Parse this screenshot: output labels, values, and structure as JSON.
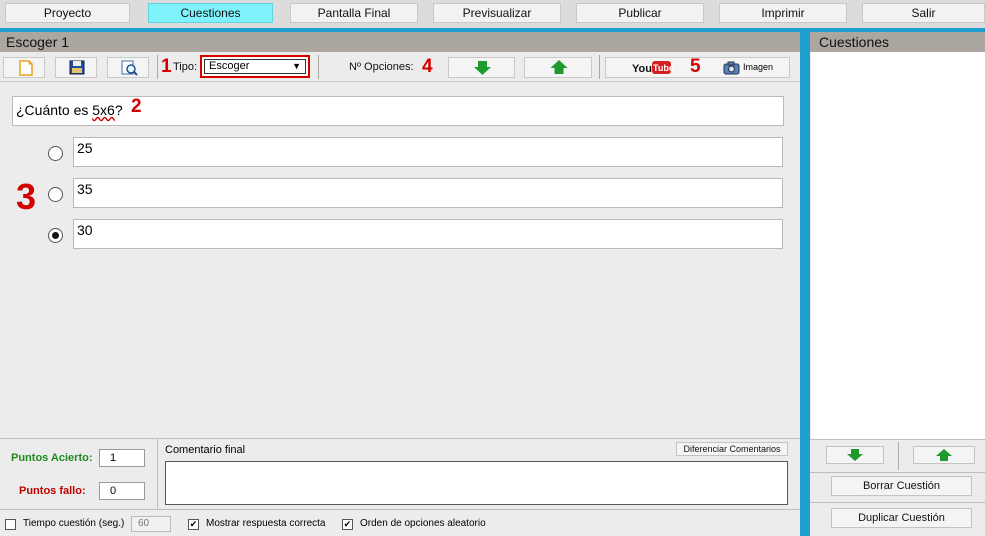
{
  "nav": {
    "items": [
      {
        "label": "Proyecto",
        "active": false
      },
      {
        "label": "Cuestiones",
        "active": true
      },
      {
        "label": "Pantalla Final",
        "active": false
      },
      {
        "label": "Previsualizar",
        "active": false
      },
      {
        "label": "Publicar",
        "active": false
      },
      {
        "label": "Imprimir",
        "active": false
      },
      {
        "label": "Salir",
        "active": false
      }
    ]
  },
  "main": {
    "title": "Escoger 1",
    "toolbar": {
      "tipo_label": "Tipo:",
      "tipo_value": "Escoger",
      "opciones_label": "Nº Opciones:",
      "youtube_label": "YouTube",
      "imagen_label": "Imagen",
      "markers": {
        "m1": "1",
        "m2": "2",
        "m3": "3",
        "m4": "4",
        "m5": "5"
      }
    },
    "question": {
      "text_prefix": "¿Cuánto es ",
      "text_underlined": "5x6",
      "text_suffix": "?"
    },
    "options": [
      {
        "value": "25",
        "selected": false
      },
      {
        "value": "35",
        "selected": false
      },
      {
        "value": "30",
        "selected": true
      }
    ],
    "bottom": {
      "puntos_acierto_label": "Puntos Acierto:",
      "puntos_acierto_value": "1",
      "puntos_fallo_label": "Puntos fallo:",
      "puntos_fallo_value": "0",
      "comentario_label": "Comentario final",
      "diferenciar_label": "Diferenciar Comentarios",
      "tiempo_label": "Tiempo cuestión (seg.)",
      "tiempo_value": "60",
      "mostrar_label": "Mostrar respuesta correcta",
      "orden_label": "Orden de opciones aleatorio"
    }
  },
  "sidebar": {
    "title": "Cuestiones",
    "borrar_label": "Borrar Cuestión",
    "duplicar_label": "Duplicar Cuestión"
  },
  "colors": {
    "accent": "#1e9fd0",
    "active_tab": "#7ff3fb",
    "marker_red": "#d40000",
    "arrow_green": "#1f9a2e",
    "puntos_acierto": "#1f8a1f",
    "puntos_fallo": "#c00000"
  },
  "icons": [
    "new-document-icon",
    "save-icon",
    "preview-icon",
    "arrow-down-icon",
    "arrow-up-icon",
    "youtube-icon",
    "camera-icon",
    "checkbox-icon"
  ]
}
